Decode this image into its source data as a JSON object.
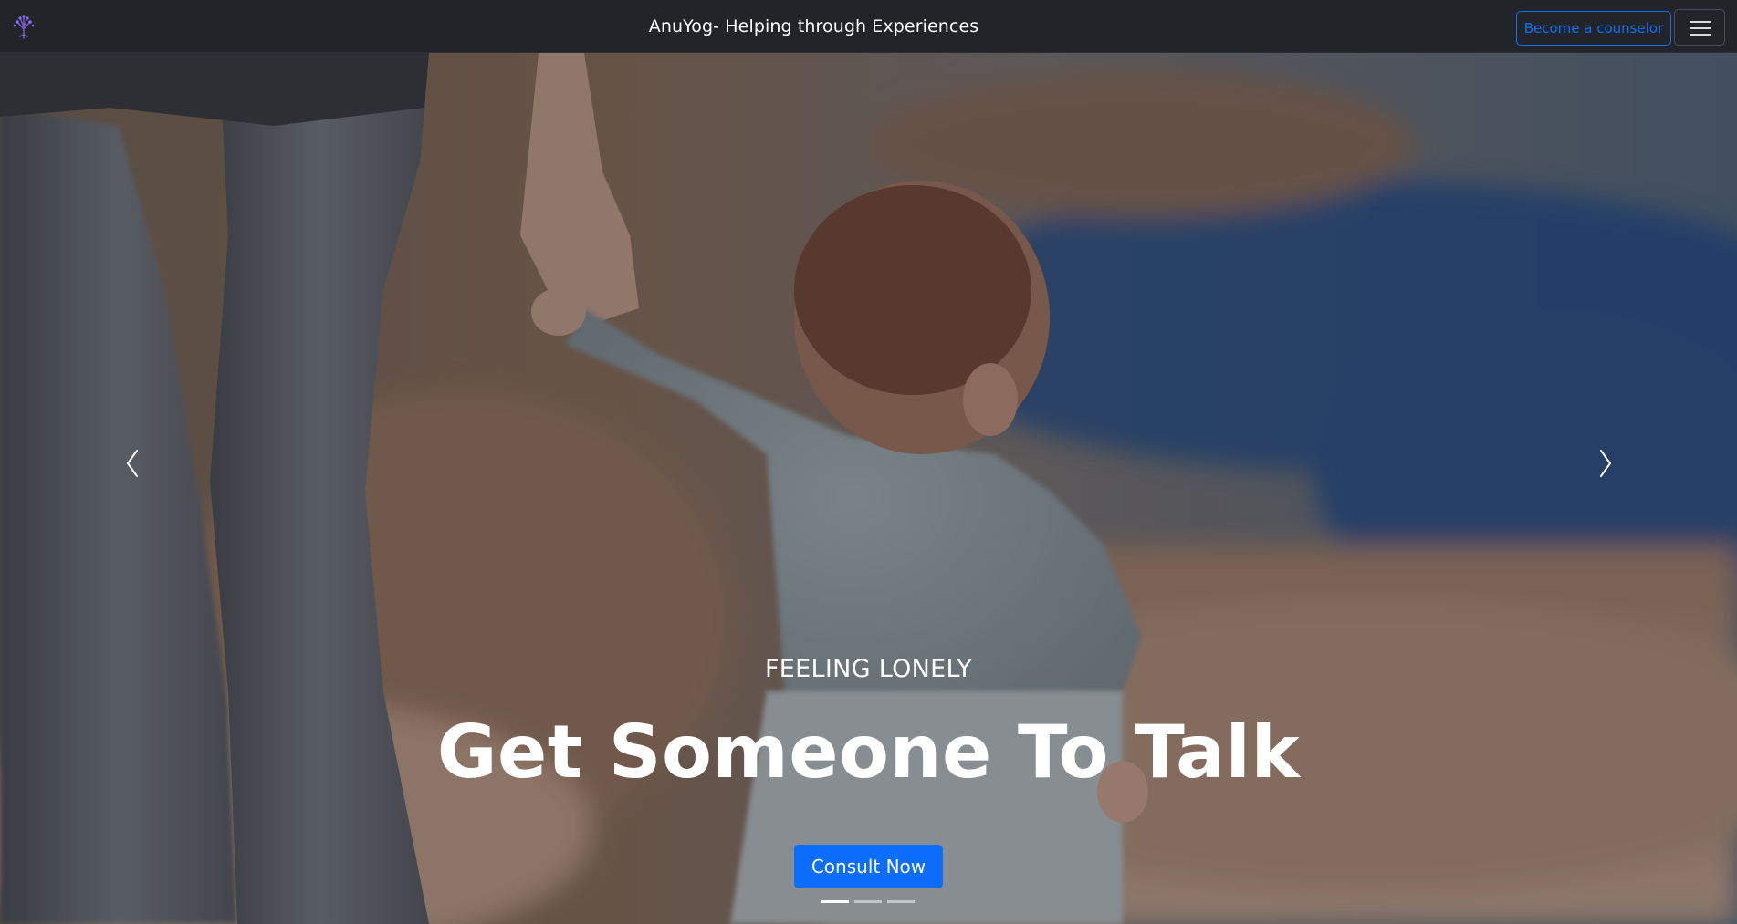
{
  "navbar": {
    "brand_icon": "tree-logo-icon",
    "title": "AnuYog- Helping through Experiences",
    "counselor_button": "Become a counselor",
    "toggler_icon": "hamburger-menu-icon"
  },
  "hero": {
    "subtitle": "FEELING LONELY",
    "title": "Get Someone To Talk",
    "cta_label": "Consult Now",
    "prev_icon": "chevron-left-icon",
    "next_icon": "chevron-right-icon",
    "slides": [
      {
        "active": true
      },
      {
        "active": false
      },
      {
        "active": false
      }
    ]
  },
  "colors": {
    "navbar_bg": "#212529",
    "primary": "#0d6efd",
    "text_light": "#ffffff"
  }
}
